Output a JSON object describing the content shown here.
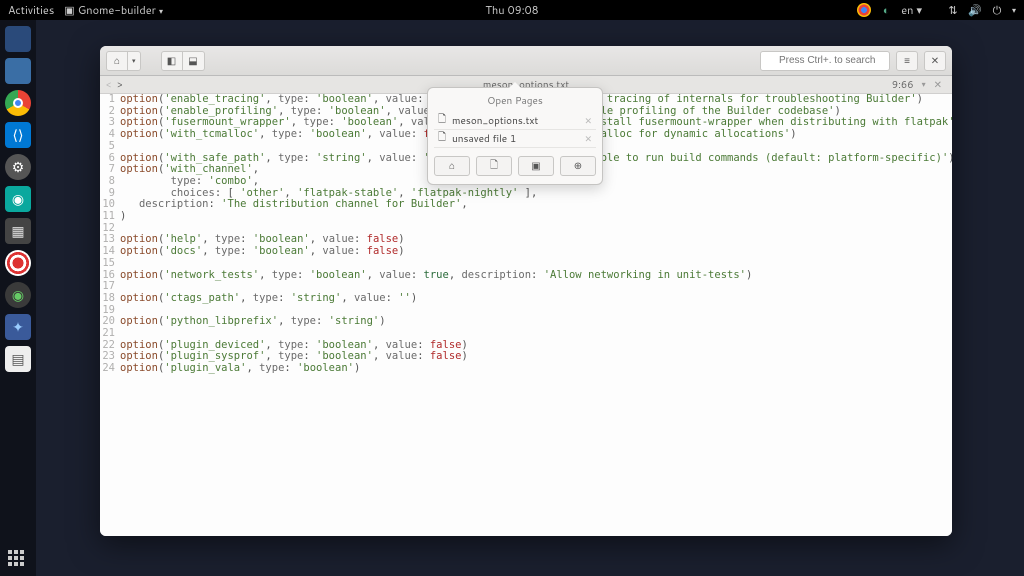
{
  "topbar": {
    "activities": "Activities",
    "app_menu": "Gnome-builder",
    "clock": "Thu 09:08",
    "lang": "en"
  },
  "headerbar": {
    "search_placeholder": "Press Ctrl+. to search"
  },
  "fileheader": {
    "filename": "meson_options.txt",
    "cursor": "9:66"
  },
  "popover": {
    "title": "Open Pages",
    "items": [
      {
        "label": "meson_options.txt"
      },
      {
        "label": "unsaved file 1"
      }
    ]
  },
  "code_lines": [
    {
      "n": 1,
      "tokens": [
        [
          "fn",
          "option"
        ],
        [
          "p",
          "("
        ],
        [
          "key",
          "'enable_tracing'"
        ],
        [
          "p",
          ", "
        ],
        [
          "arg",
          "type"
        ],
        [
          "p",
          ": "
        ],
        [
          "key",
          "'boolean'"
        ],
        [
          "p",
          ", "
        ],
        [
          "arg",
          "value"
        ],
        [
          "p",
          ": "
        ],
        [
          "false",
          "false"
        ],
        [
          "p",
          ", "
        ],
        [
          "arg",
          "description"
        ],
        [
          "p",
          ": "
        ],
        [
          "key",
          "'Enable tracing of internals for troubleshooting Builder'"
        ],
        [
          "p",
          ")"
        ]
      ]
    },
    {
      "n": 2,
      "tokens": [
        [
          "fn",
          "option"
        ],
        [
          "p",
          "("
        ],
        [
          "key",
          "'enable_profiling'"
        ],
        [
          "p",
          ", "
        ],
        [
          "arg",
          "type"
        ],
        [
          "p",
          ": "
        ],
        [
          "key",
          "'boolean'"
        ],
        [
          "p",
          ", "
        ],
        [
          "arg",
          "value"
        ],
        [
          "p",
          ": "
        ],
        [
          "false",
          "false"
        ],
        [
          "p",
          ", "
        ],
        [
          "arg",
          "description"
        ],
        [
          "p",
          ": "
        ],
        [
          "key",
          "'Enable profiling of the Builder codebase'"
        ],
        [
          "p",
          ")"
        ]
      ]
    },
    {
      "n": 3,
      "tokens": [
        [
          "fn",
          "option"
        ],
        [
          "p",
          "("
        ],
        [
          "key",
          "'fusermount_wrapper'"
        ],
        [
          "p",
          ", "
        ],
        [
          "arg",
          "type"
        ],
        [
          "p",
          ": "
        ],
        [
          "key",
          "'boolean'"
        ],
        [
          "p",
          ", "
        ],
        [
          "arg",
          "value"
        ],
        [
          "p",
          ": "
        ],
        [
          "false",
          "false"
        ],
        [
          "p",
          ", "
        ],
        [
          "arg",
          "description"
        ],
        [
          "p",
          ": "
        ],
        [
          "key",
          "'Install fusermount-wrapper when distributing with flatpak'"
        ],
        [
          "p",
          ")"
        ]
      ]
    },
    {
      "n": 4,
      "tokens": [
        [
          "fn",
          "option"
        ],
        [
          "p",
          "("
        ],
        [
          "key",
          "'with_tcmalloc'"
        ],
        [
          "p",
          ", "
        ],
        [
          "arg",
          "type"
        ],
        [
          "p",
          ": "
        ],
        [
          "key",
          "'boolean'"
        ],
        [
          "p",
          ", "
        ],
        [
          "arg",
          "value"
        ],
        [
          "p",
          ": "
        ],
        [
          "false",
          "false"
        ],
        [
          "p",
          ", "
        ],
        [
          "arg",
          "description"
        ],
        [
          "p",
          ": "
        ],
        [
          "key",
          "'Use tcmalloc for dynamic allocations'"
        ],
        [
          "p",
          ")"
        ]
      ]
    },
    {
      "n": 5,
      "tokens": []
    },
    {
      "n": 6,
      "tokens": [
        [
          "fn",
          "option"
        ],
        [
          "p",
          "("
        ],
        [
          "key",
          "'with_safe_path'"
        ],
        [
          "p",
          ", "
        ],
        [
          "arg",
          "type"
        ],
        [
          "p",
          ": "
        ],
        [
          "key",
          "'string'"
        ],
        [
          "p",
          ", "
        ],
        [
          "arg",
          "value"
        ],
        [
          "p",
          ": "
        ],
        [
          "key",
          "''"
        ],
        [
          "p",
          ", "
        ],
        [
          "arg",
          "description"
        ],
        [
          "p",
          ": "
        ],
        [
          "key",
          "'PATH variable to run build commands (default: platform-specific)'"
        ],
        [
          "p",
          ")"
        ]
      ]
    },
    {
      "n": 7,
      "tokens": [
        [
          "fn",
          "option"
        ],
        [
          "p",
          "("
        ],
        [
          "key",
          "'with_channel'"
        ],
        [
          "p",
          ","
        ]
      ]
    },
    {
      "n": 8,
      "tokens": [
        [
          "p",
          "        "
        ],
        [
          "arg",
          "type"
        ],
        [
          "p",
          ": "
        ],
        [
          "key",
          "'combo'"
        ],
        [
          "p",
          ","
        ]
      ]
    },
    {
      "n": 9,
      "tokens": [
        [
          "p",
          "        "
        ],
        [
          "arg",
          "choices"
        ],
        [
          "p",
          ": [ "
        ],
        [
          "key",
          "'other'"
        ],
        [
          "p",
          ", "
        ],
        [
          "key",
          "'flatpak-stable'"
        ],
        [
          "p",
          ", "
        ],
        [
          "key",
          "'flatpak-nightly'"
        ],
        [
          "p",
          " ],"
        ]
      ]
    },
    {
      "n": 10,
      "tokens": [
        [
          "p",
          "   "
        ],
        [
          "arg",
          "description"
        ],
        [
          "p",
          ": "
        ],
        [
          "key",
          "'The distribution channel for Builder'"
        ],
        [
          "p",
          ","
        ]
      ]
    },
    {
      "n": 11,
      "tokens": [
        [
          "p",
          ")"
        ]
      ]
    },
    {
      "n": 12,
      "tokens": []
    },
    {
      "n": 13,
      "tokens": [
        [
          "fn",
          "option"
        ],
        [
          "p",
          "("
        ],
        [
          "key",
          "'help'"
        ],
        [
          "p",
          ", "
        ],
        [
          "arg",
          "type"
        ],
        [
          "p",
          ": "
        ],
        [
          "key",
          "'boolean'"
        ],
        [
          "p",
          ", "
        ],
        [
          "arg",
          "value"
        ],
        [
          "p",
          ": "
        ],
        [
          "false",
          "false"
        ],
        [
          "p",
          ")"
        ]
      ]
    },
    {
      "n": 14,
      "tokens": [
        [
          "fn",
          "option"
        ],
        [
          "p",
          "("
        ],
        [
          "key",
          "'docs'"
        ],
        [
          "p",
          ", "
        ],
        [
          "arg",
          "type"
        ],
        [
          "p",
          ": "
        ],
        [
          "key",
          "'boolean'"
        ],
        [
          "p",
          ", "
        ],
        [
          "arg",
          "value"
        ],
        [
          "p",
          ": "
        ],
        [
          "false",
          "false"
        ],
        [
          "p",
          ")"
        ]
      ]
    },
    {
      "n": 15,
      "tokens": []
    },
    {
      "n": 16,
      "tokens": [
        [
          "fn",
          "option"
        ],
        [
          "p",
          "("
        ],
        [
          "key",
          "'network_tests'"
        ],
        [
          "p",
          ", "
        ],
        [
          "arg",
          "type"
        ],
        [
          "p",
          ": "
        ],
        [
          "key",
          "'boolean'"
        ],
        [
          "p",
          ", "
        ],
        [
          "arg",
          "value"
        ],
        [
          "p",
          ": "
        ],
        [
          "true",
          "true"
        ],
        [
          "p",
          ", "
        ],
        [
          "arg",
          "description"
        ],
        [
          "p",
          ": "
        ],
        [
          "key",
          "'Allow networking in unit-tests'"
        ],
        [
          "p",
          ")"
        ]
      ]
    },
    {
      "n": 17,
      "tokens": []
    },
    {
      "n": 18,
      "tokens": [
        [
          "fn",
          "option"
        ],
        [
          "p",
          "("
        ],
        [
          "key",
          "'ctags_path'"
        ],
        [
          "p",
          ", "
        ],
        [
          "arg",
          "type"
        ],
        [
          "p",
          ": "
        ],
        [
          "key",
          "'string'"
        ],
        [
          "p",
          ", "
        ],
        [
          "arg",
          "value"
        ],
        [
          "p",
          ": "
        ],
        [
          "key",
          "''"
        ],
        [
          "p",
          ")"
        ]
      ]
    },
    {
      "n": 19,
      "tokens": []
    },
    {
      "n": 20,
      "tokens": [
        [
          "fn",
          "option"
        ],
        [
          "p",
          "("
        ],
        [
          "key",
          "'python_libprefix'"
        ],
        [
          "p",
          ", "
        ],
        [
          "arg",
          "type"
        ],
        [
          "p",
          ": "
        ],
        [
          "key",
          "'string'"
        ],
        [
          "p",
          ")"
        ]
      ]
    },
    {
      "n": 21,
      "tokens": []
    },
    {
      "n": 22,
      "tokens": [
        [
          "fn",
          "option"
        ],
        [
          "p",
          "("
        ],
        [
          "key",
          "'plugin_deviced'"
        ],
        [
          "p",
          ", "
        ],
        [
          "arg",
          "type"
        ],
        [
          "p",
          ": "
        ],
        [
          "key",
          "'boolean'"
        ],
        [
          "p",
          ", "
        ],
        [
          "arg",
          "value"
        ],
        [
          "p",
          ": "
        ],
        [
          "false",
          "false"
        ],
        [
          "p",
          ")"
        ]
      ]
    },
    {
      "n": 23,
      "tokens": [
        [
          "fn",
          "option"
        ],
        [
          "p",
          "("
        ],
        [
          "key",
          "'plugin_sysprof'"
        ],
        [
          "p",
          ", "
        ],
        [
          "arg",
          "type"
        ],
        [
          "p",
          ": "
        ],
        [
          "key",
          "'boolean'"
        ],
        [
          "p",
          ", "
        ],
        [
          "arg",
          "value"
        ],
        [
          "p",
          ": "
        ],
        [
          "false",
          "false"
        ],
        [
          "p",
          ")"
        ]
      ]
    },
    {
      "n": 24,
      "tokens": [
        [
          "fn",
          "option"
        ],
        [
          "p",
          "("
        ],
        [
          "key",
          "'plugin_vala'"
        ],
        [
          "p",
          ", "
        ],
        [
          "arg",
          "type"
        ],
        [
          "p",
          ": "
        ],
        [
          "key",
          "'boolean'"
        ],
        [
          "p",
          ")"
        ]
      ]
    }
  ]
}
